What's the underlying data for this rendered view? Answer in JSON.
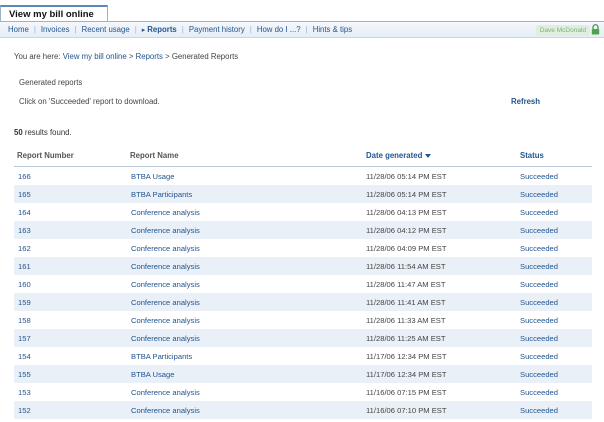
{
  "app": {
    "title": "View my bill online"
  },
  "nav": {
    "items": [
      {
        "label": "Home",
        "name": "nav-home"
      },
      {
        "label": "Invoices",
        "name": "nav-invoices"
      },
      {
        "label": "Recent usage",
        "name": "nav-recent-usage"
      },
      {
        "label": "Reports",
        "name": "nav-reports",
        "active": true
      },
      {
        "label": "Payment history",
        "name": "nav-payment-history"
      },
      {
        "label": "How do I ...?",
        "name": "nav-how-do-i"
      },
      {
        "label": "Hints & tips",
        "name": "nav-hints-tips"
      }
    ],
    "user_name": "Dave McDonald",
    "lock_icon": "lock-icon"
  },
  "breadcrumb": {
    "prefix": "You are here:",
    "link1": "View my bill online",
    "sep1": ">",
    "link2": "Reports",
    "sep2": ">",
    "current": "Generated Reports"
  },
  "section": {
    "title": "Generated reports",
    "instruction": "Click on 'Succeeded' report to download.",
    "refresh_label": "Refresh"
  },
  "results": {
    "count": "50",
    "suffix": "results found."
  },
  "table": {
    "headers": {
      "number": "Report Number",
      "name": "Report Name",
      "date": "Date generated",
      "status": "Status"
    },
    "sort_icon": "sort-descending-icon",
    "rows": [
      {
        "number": "166",
        "name": "BTBA Usage",
        "date": "11/28/06 05:14 PM EST",
        "status": "Succeeded"
      },
      {
        "number": "165",
        "name": "BTBA Participants",
        "date": "11/28/06 05:14 PM EST",
        "status": "Succeeded"
      },
      {
        "number": "164",
        "name": "Conference analysis",
        "date": "11/28/06 04:13 PM EST",
        "status": "Succeeded"
      },
      {
        "number": "163",
        "name": "Conference analysis",
        "date": "11/28/06 04:12 PM EST",
        "status": "Succeeded"
      },
      {
        "number": "162",
        "name": "Conference analysis",
        "date": "11/28/06 04:09 PM EST",
        "status": "Succeeded"
      },
      {
        "number": "161",
        "name": "Conference analysis",
        "date": "11/28/06 11:54 AM EST",
        "status": "Succeeded"
      },
      {
        "number": "160",
        "name": "Conference analysis",
        "date": "11/28/06 11:47 AM EST",
        "status": "Succeeded"
      },
      {
        "number": "159",
        "name": "Conference analysis",
        "date": "11/28/06 11:41 AM EST",
        "status": "Succeeded"
      },
      {
        "number": "158",
        "name": "Conference analysis",
        "date": "11/28/06 11:33 AM EST",
        "status": "Succeeded"
      },
      {
        "number": "157",
        "name": "Conference analysis",
        "date": "11/28/06 11:25 AM EST",
        "status": "Succeeded"
      },
      {
        "number": "154",
        "name": "BTBA Participants",
        "date": "11/17/06 12:34 PM EST",
        "status": "Succeeded"
      },
      {
        "number": "155",
        "name": "BTBA Usage",
        "date": "11/17/06 12:34 PM EST",
        "status": "Succeeded"
      },
      {
        "number": "153",
        "name": "Conference analysis",
        "date": "11/16/06 07:15 PM EST",
        "status": "Succeeded"
      },
      {
        "number": "152",
        "name": "Conference analysis",
        "date": "11/16/06 07:10 PM EST",
        "status": "Succeeded"
      }
    ]
  },
  "colors": {
    "link": "#23558f",
    "row_alt": "#e9f0f8",
    "border": "#9bb3cc"
  }
}
